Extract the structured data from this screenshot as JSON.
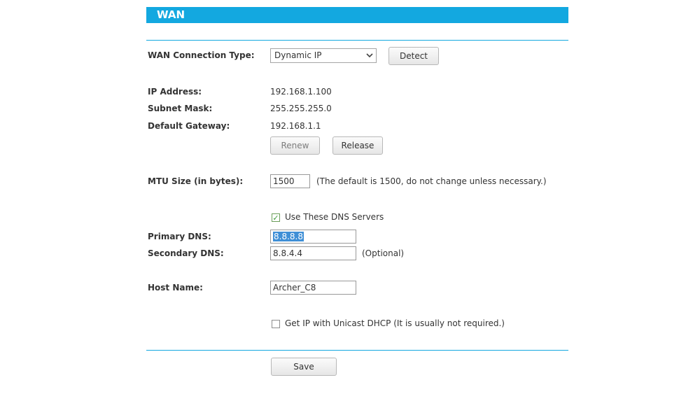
{
  "header": {
    "title": "WAN"
  },
  "connection_type": {
    "label": "WAN Connection Type:",
    "selected": "Dynamic IP",
    "detect_label": "Detect"
  },
  "ip_info": {
    "ip_label": "IP Address:",
    "ip_value": "192.168.1.100",
    "subnet_label": "Subnet Mask:",
    "subnet_value": "255.255.255.0",
    "gateway_label": "Default Gateway:",
    "gateway_value": "192.168.1.1",
    "renew_label": "Renew",
    "release_label": "Release"
  },
  "mtu": {
    "label": "MTU Size (in bytes):",
    "value": "1500",
    "hint": "(The default is 1500, do not change unless necessary.)"
  },
  "dns": {
    "use_dns_label": "Use These DNS Servers",
    "use_dns_checked": true,
    "primary_label": "Primary DNS:",
    "primary_value": "8.8.8.8",
    "secondary_label": "Secondary DNS:",
    "secondary_value": "8.8.4.4",
    "secondary_hint": "(Optional)"
  },
  "host": {
    "label": "Host Name:",
    "value": "Archer_C8"
  },
  "unicast": {
    "label": "Get IP with Unicast DHCP (It is usually not required.)",
    "checked": false
  },
  "save_label": "Save",
  "colors": {
    "accent": "#13a8e0",
    "selection": "#3f8fd6",
    "check": "#3f9b3a"
  },
  "icons": {
    "dropdown": "chevron-down-icon",
    "check": "checkmark-icon"
  }
}
